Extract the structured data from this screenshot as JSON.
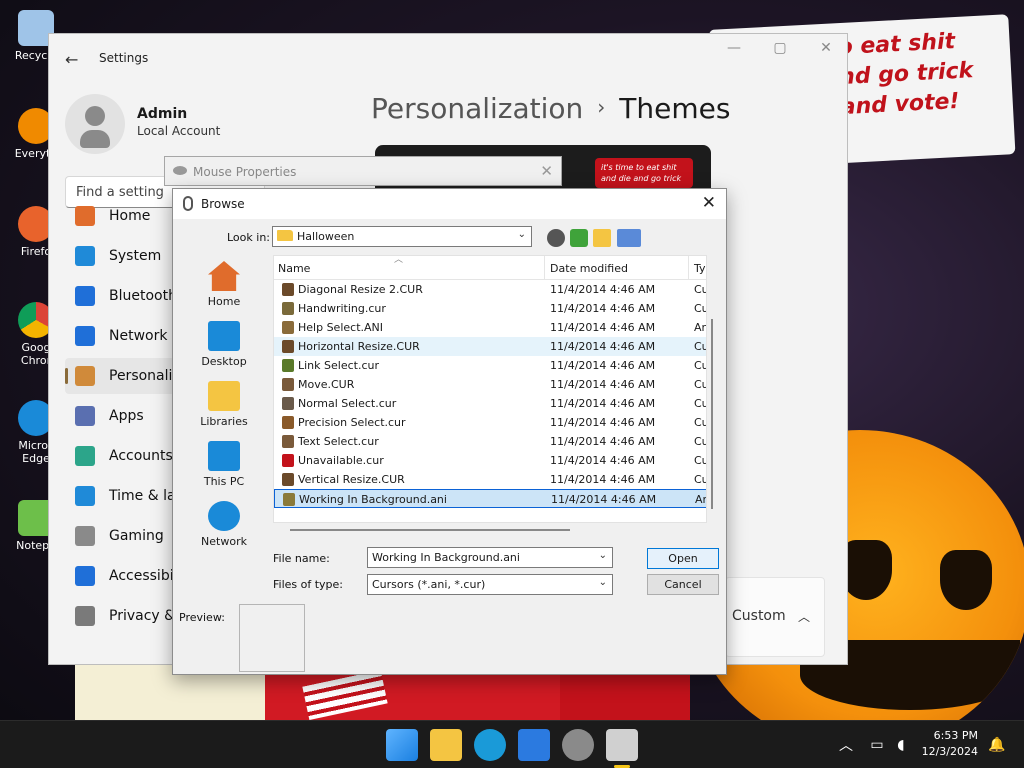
{
  "desktop": {
    "wallpaper_sign_lines": [
      "o eat shit",
      "nd go trick",
      "and vote!"
    ],
    "icons": [
      {
        "label": "Recycle",
        "color": "#9fc4e8"
      },
      {
        "label": "Everyth",
        "color": "#f08a00"
      },
      {
        "label": "Firefo",
        "color": "#e8632c"
      },
      {
        "label": "Goog Chror",
        "color": "#2f9e44"
      },
      {
        "label": "Micros Edge",
        "color": "#1a8ad8"
      },
      {
        "label": "Notepa",
        "color": "#6dbf4a"
      }
    ]
  },
  "taskbar": {
    "clock_time": "6:53 PM",
    "clock_date": "12/3/2024",
    "apps": [
      {
        "name": "start",
        "color": "#3a9bf0"
      },
      {
        "name": "file-explorer",
        "color": "#f4c542"
      },
      {
        "name": "edge",
        "color": "#1a9ad8"
      },
      {
        "name": "store",
        "color": "#2b7ae0"
      },
      {
        "name": "settings",
        "color": "#8a8a8a"
      },
      {
        "name": "mouse-properties",
        "color": "#d0d0d0"
      }
    ]
  },
  "settings": {
    "title": "Settings",
    "user_name": "Admin",
    "account_type": "Local Account",
    "search_placeholder": "Find a setting",
    "breadcrumb_parent": "Personalization",
    "breadcrumb_separator": "›",
    "breadcrumb_current": "Themes",
    "custom_label": "Custom",
    "nav": [
      {
        "label": "Home",
        "color": "#e06c2c"
      },
      {
        "label": "System",
        "color": "#1f8ad8"
      },
      {
        "label": "Bluetooth",
        "color": "#1f6fd8"
      },
      {
        "label": "Network",
        "color": "#1f6fd8"
      },
      {
        "label": "Personali",
        "color": "#d08a3a"
      },
      {
        "label": "Apps",
        "color": "#5a6fb0"
      },
      {
        "label": "Accounts",
        "color": "#2ca58a"
      },
      {
        "label": "Time & la",
        "color": "#1f8ad8"
      },
      {
        "label": "Gaming",
        "color": "#8a8a8a"
      },
      {
        "label": "Accessibi",
        "color": "#1f6fd8"
      },
      {
        "label": "Privacy & s",
        "color": "#7a7a7a"
      }
    ]
  },
  "mouse_properties": {
    "title": "Mouse Properties",
    "banner": "it's time to eat shit and die and go trick"
  },
  "browse": {
    "title": "Browse",
    "look_in_label": "Look in:",
    "look_in_value": "Halloween",
    "places": [
      {
        "label": "Home",
        "color": "#e06c2c"
      },
      {
        "label": "Desktop",
        "color": "#1a8ad8"
      },
      {
        "label": "Libraries",
        "color": "#f4c542"
      },
      {
        "label": "This PC",
        "color": "#1a8ad8"
      },
      {
        "label": "Network",
        "color": "#1a8ad8"
      }
    ],
    "columns": [
      "Name",
      "Date modified",
      "Ty"
    ],
    "files": [
      {
        "name": "Diagonal Resize 2.CUR",
        "date": "11/4/2014 4:46 AM",
        "type": "Cu",
        "icon_color": "#6b4a2a"
      },
      {
        "name": "Handwriting.cur",
        "date": "11/4/2014 4:46 AM",
        "type": "Cu",
        "icon_color": "#7a6a3a"
      },
      {
        "name": "Help Select.ANI",
        "date": "11/4/2014 4:46 AM",
        "type": "Ar",
        "icon_color": "#8a6b3a"
      },
      {
        "name": "Horizontal Resize.CUR",
        "date": "11/4/2014 4:46 AM",
        "type": "Cu",
        "icon_color": "#6b4a2a"
      },
      {
        "name": "Link Select.cur",
        "date": "11/4/2014 4:46 AM",
        "type": "Cu",
        "icon_color": "#5a7a2a"
      },
      {
        "name": "Move.CUR",
        "date": "11/4/2014 4:46 AM",
        "type": "Cu",
        "icon_color": "#7a5a3a"
      },
      {
        "name": "Normal Select.cur",
        "date": "11/4/2014 4:46 AM",
        "type": "Cu",
        "icon_color": "#6a5a4a"
      },
      {
        "name": "Precision Select.cur",
        "date": "11/4/2014 4:46 AM",
        "type": "Cu",
        "icon_color": "#8a5a2a"
      },
      {
        "name": "Text Select.cur",
        "date": "11/4/2014 4:46 AM",
        "type": "Cu",
        "icon_color": "#7a5a3a"
      },
      {
        "name": "Unavailable.cur",
        "date": "11/4/2014 4:46 AM",
        "type": "Cu",
        "icon_color": "#c3121b"
      },
      {
        "name": "Vertical Resize.CUR",
        "date": "11/4/2014 4:46 AM",
        "type": "Cu",
        "icon_color": "#6b4a2a"
      },
      {
        "name": "Working In Background.ani",
        "date": "11/4/2014 4:46 AM",
        "type": "Ar",
        "icon_color": "#8a7a3a"
      }
    ],
    "selected_file": "Working In Background.ani",
    "hovered_file": "Horizontal Resize.CUR",
    "file_name_label": "File name:",
    "file_name_value": "Working In Background.ani",
    "file_type_label": "Files of type:",
    "file_type_value": "Cursors (*.ani, *.cur)",
    "open_label": "Open",
    "cancel_label": "Cancel",
    "preview_label": "Preview:"
  }
}
